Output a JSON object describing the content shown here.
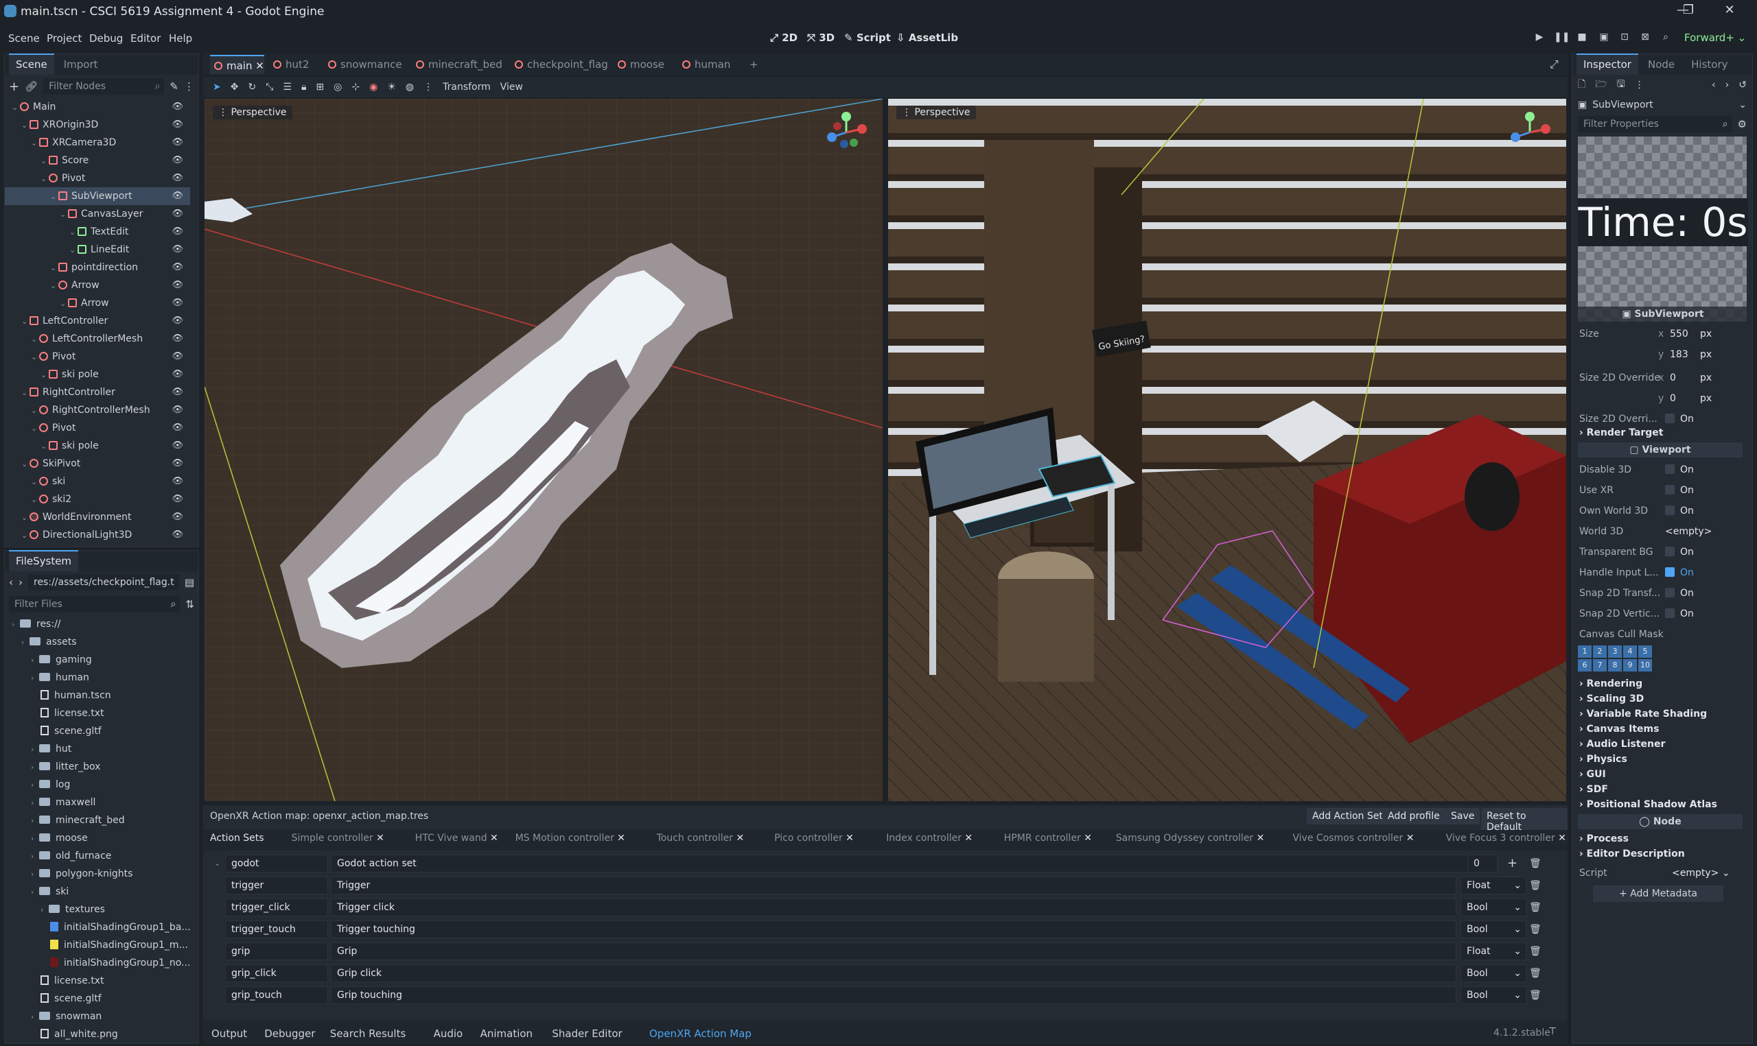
{
  "window": {
    "title": "main.tscn - CSCI 5619 Assignment 4 - Godot Engine"
  },
  "menu": [
    "Scene",
    "Project",
    "Debug",
    "Editor",
    "Help"
  ],
  "workspaces": [
    "2D",
    "3D",
    "Script",
    "AssetLib"
  ],
  "renderer": "Forward+",
  "scene_dock": {
    "tabs": [
      "Scene",
      "Import"
    ],
    "filter_placeholder": "Filter Nodes",
    "nodes": [
      {
        "label": "Main",
        "depth": 0,
        "icon": "node3d-icon"
      },
      {
        "label": "XROrigin3D",
        "depth": 1,
        "icon": "xr-origin-icon"
      },
      {
        "label": "XRCamera3D",
        "depth": 2,
        "icon": "xr-camera-icon"
      },
      {
        "label": "Score",
        "depth": 3,
        "icon": "label3d-icon"
      },
      {
        "label": "Pivot",
        "depth": 3,
        "icon": "node3d-icon"
      },
      {
        "label": "SubViewport",
        "depth": 4,
        "icon": "subviewport-icon"
      },
      {
        "label": "CanvasLayer",
        "depth": 5,
        "icon": "canvas-layer-icon"
      },
      {
        "label": "TextEdit",
        "depth": 6,
        "icon": "textedit-icon"
      },
      {
        "label": "LineEdit",
        "depth": 6,
        "icon": "lineedit-icon"
      },
      {
        "label": "pointdirection",
        "depth": 4,
        "icon": "mesh-icon"
      },
      {
        "label": "Arrow",
        "depth": 4,
        "icon": "node3d-icon"
      },
      {
        "label": "Arrow",
        "depth": 5,
        "icon": "mesh-icon"
      },
      {
        "label": "LeftController",
        "depth": 1,
        "icon": "xr-controller-icon"
      },
      {
        "label": "LeftControllerMesh",
        "depth": 2,
        "icon": "node3d-icon"
      },
      {
        "label": "Pivot",
        "depth": 2,
        "icon": "node3d-icon"
      },
      {
        "label": "ski pole",
        "depth": 3,
        "icon": "mesh-icon"
      },
      {
        "label": "RightController",
        "depth": 1,
        "icon": "xr-controller-icon"
      },
      {
        "label": "RightControllerMesh",
        "depth": 2,
        "icon": "node3d-icon"
      },
      {
        "label": "Pivot",
        "depth": 2,
        "icon": "node3d-icon"
      },
      {
        "label": "ski pole",
        "depth": 3,
        "icon": "mesh-icon"
      },
      {
        "label": "SkiPivot",
        "depth": 1,
        "icon": "node3d-icon"
      },
      {
        "label": "ski",
        "depth": 2,
        "icon": "node3d-icon"
      },
      {
        "label": "ski2",
        "depth": 2,
        "icon": "node3d-icon"
      },
      {
        "label": "WorldEnvironment",
        "depth": 1,
        "icon": "world-environment-icon"
      },
      {
        "label": "DirectionalLight3D",
        "depth": 1,
        "icon": "light-icon"
      }
    ]
  },
  "filesystem": {
    "title": "FileSystem",
    "path": "res://assets/checkpoint_flag.t",
    "filter_placeholder": "Filter Files",
    "items": [
      {
        "label": "res://",
        "depth": 0,
        "type": "folder"
      },
      {
        "label": "assets",
        "depth": 1,
        "type": "folder"
      },
      {
        "label": "gaming",
        "depth": 2,
        "type": "folder"
      },
      {
        "label": "human",
        "depth": 2,
        "type": "folder"
      },
      {
        "label": "human.tscn",
        "depth": 3,
        "type": "file"
      },
      {
        "label": "license.txt",
        "depth": 3,
        "type": "file"
      },
      {
        "label": "scene.gltf",
        "depth": 3,
        "type": "file"
      },
      {
        "label": "hut",
        "depth": 2,
        "type": "folder"
      },
      {
        "label": "litter_box",
        "depth": 2,
        "type": "folder"
      },
      {
        "label": "log",
        "depth": 2,
        "type": "folder"
      },
      {
        "label": "maxwell",
        "depth": 2,
        "type": "folder"
      },
      {
        "label": "minecraft_bed",
        "depth": 2,
        "type": "folder"
      },
      {
        "label": "moose",
        "depth": 2,
        "type": "folder"
      },
      {
        "label": "old_furnace",
        "depth": 2,
        "type": "folder"
      },
      {
        "label": "polygon-knights",
        "depth": 2,
        "type": "folder"
      },
      {
        "label": "ski",
        "depth": 2,
        "type": "folder"
      },
      {
        "label": "textures",
        "depth": 3,
        "type": "folder"
      },
      {
        "label": "initialShadingGroup1_ba...",
        "depth": 4,
        "type": "image-blue"
      },
      {
        "label": "initialShadingGroup1_m...",
        "depth": 4,
        "type": "image-yellow"
      },
      {
        "label": "initialShadingGroup1_no...",
        "depth": 4,
        "type": "image-red"
      },
      {
        "label": "license.txt",
        "depth": 3,
        "type": "file"
      },
      {
        "label": "scene.gltf",
        "depth": 3,
        "type": "file"
      },
      {
        "label": "snowman",
        "depth": 2,
        "type": "folder"
      },
      {
        "label": "all_white.png",
        "depth": 3,
        "type": "file"
      }
    ]
  },
  "editor_tabs": [
    "main",
    "hut2",
    "snowmance",
    "minecraft_bed",
    "checkpoint_flag",
    "moose",
    "human"
  ],
  "toolbar": {
    "transform": "Transform",
    "view": "View"
  },
  "viewports": {
    "left_label": "Perspective",
    "right_label": "Perspective",
    "sign_text": "Go Skiing?"
  },
  "inspector": {
    "tabs": [
      "Inspector",
      "Node",
      "History"
    ],
    "object": "SubViewport",
    "filter_placeholder": "Filter Properties",
    "preview_text": "Time: 0s",
    "preview_caption": "SubViewport",
    "props": [
      {
        "name": "Size",
        "axis": "x",
        "value": "550",
        "unit": "px"
      },
      {
        "name": "",
        "axis": "y",
        "value": "183",
        "unit": "px"
      },
      {
        "name": "Size 2D Override",
        "axis": "x",
        "value": "0",
        "unit": "px"
      },
      {
        "name": "",
        "axis": "y",
        "value": "0",
        "unit": "px"
      }
    ],
    "override_label": "Size 2D Overri...",
    "override_val": "On",
    "render_target": "Render Target",
    "viewport_section": "Viewport",
    "bools": [
      {
        "name": "Disable 3D",
        "value": "On",
        "checked": false
      },
      {
        "name": "Use XR",
        "value": "On",
        "checked": false
      },
      {
        "name": "Own World 3D",
        "value": "On",
        "checked": false
      },
      {
        "name": "World 3D",
        "value": "<empty>",
        "checked": null
      },
      {
        "name": "Transparent BG",
        "value": "On",
        "checked": false
      },
      {
        "name": "Handle Input L...",
        "value": "On",
        "checked": true
      },
      {
        "name": "Snap 2D Transf...",
        "value": "On",
        "checked": false
      },
      {
        "name": "Snap 2D Vertic...",
        "value": "On",
        "checked": false
      }
    ],
    "cull_mask": "Canvas Cull Mask",
    "cull_bits_row1": [
      "1",
      "2",
      "3",
      "4",
      "5"
    ],
    "cull_bits_row2": [
      "6",
      "7",
      "8",
      "9",
      "10"
    ],
    "sections": [
      "Rendering",
      "Scaling 3D",
      "Variable Rate Shading",
      "Canvas Items",
      "Audio Listener",
      "Physics",
      "GUI",
      "SDF",
      "Positional Shadow Atlas"
    ],
    "node_section": "Node",
    "node_sections": [
      "Process",
      "Editor Description"
    ],
    "script_label": "Script",
    "script_value": "<empty>",
    "add_metadata": "Add Metadata"
  },
  "action_map": {
    "header": "OpenXR Action map: openxr_action_map.tres",
    "buttons": [
      "Add Action Set",
      "Add profile",
      "Save",
      "Reset to Default"
    ],
    "tabs": [
      "Action Sets",
      "Simple controller",
      "HTC Vive wand",
      "MS Motion controller",
      "Touch controller",
      "Pico controller",
      "Index controller",
      "HPMR controller",
      "Samsung Odyssey controller",
      "Vive Cosmos controller",
      "Vive Focus 3 controller"
    ],
    "set": {
      "name": "godot",
      "desc": "Godot action set",
      "priority": "0"
    },
    "actions": [
      {
        "name": "trigger",
        "desc": "Trigger",
        "type": "Float"
      },
      {
        "name": "trigger_click",
        "desc": "Trigger click",
        "type": "Bool"
      },
      {
        "name": "trigger_touch",
        "desc": "Trigger touching",
        "type": "Bool"
      },
      {
        "name": "grip",
        "desc": "Grip",
        "type": "Float"
      },
      {
        "name": "grip_click",
        "desc": "Grip click",
        "type": "Bool"
      },
      {
        "name": "grip_touch",
        "desc": "Grip touching",
        "type": "Bool"
      }
    ]
  },
  "bottom_tabs": [
    "Output",
    "Debugger",
    "Search Results",
    "Audio",
    "Animation",
    "Shader Editor",
    "OpenXR Action Map"
  ],
  "version": "4.1.2.stable",
  "colors": {
    "accent": "#4ea6f2",
    "node_red": "#fc7f7f",
    "bg_dark": "#1d2229",
    "panel": "#252b33"
  }
}
